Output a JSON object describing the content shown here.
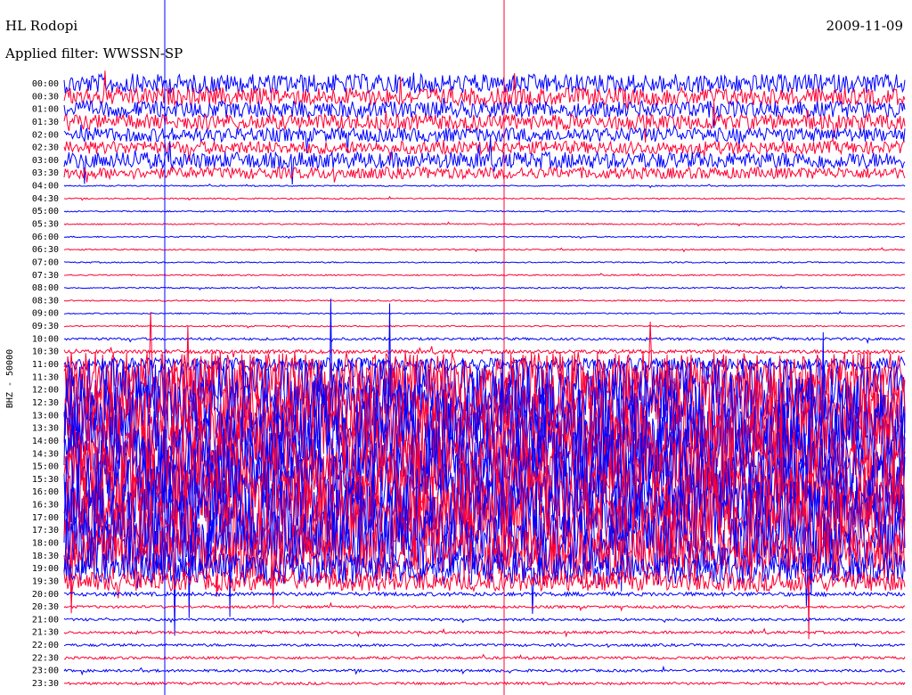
{
  "header": {
    "station": "HL Rodopi",
    "date": "2009-11-09",
    "filter_label": "Applied filter: WWSSN-SP"
  },
  "colors": {
    "trace_a": "#0000ff",
    "trace_b": "#ff0033"
  },
  "chart_data": {
    "type": "line",
    "title": "HL Rodopi",
    "subtitle": "Applied filter: WWSSN-SP",
    "ylabel": "BHZ - 50000",
    "xlabel": "",
    "grid": false,
    "legend": "none",
    "rows": [
      "00:00",
      "00:30",
      "01:00",
      "01:30",
      "02:00",
      "02:30",
      "03:00",
      "03:30",
      "04:00",
      "04:30",
      "05:00",
      "05:30",
      "06:00",
      "06:30",
      "07:00",
      "07:30",
      "08:00",
      "08:30",
      "09:00",
      "09:30",
      "10:00",
      "10:30",
      "11:00",
      "11:30",
      "12:00",
      "12:30",
      "13:00",
      "13:30",
      "14:00",
      "14:30",
      "15:00",
      "15:30",
      "16:00",
      "16:30",
      "17:00",
      "17:30",
      "18:00",
      "18:30",
      "19:00",
      "19:30",
      "20:00",
      "20:30",
      "21:00",
      "21:30",
      "22:00",
      "22:30",
      "23:00",
      "23:30"
    ],
    "row_amplitude": [
      1.5,
      1.4,
      1.3,
      1.2,
      1.1,
      1.0,
      1.3,
      0.9,
      0.1,
      0.1,
      0.1,
      0.1,
      0.1,
      0.1,
      0.1,
      0.1,
      0.1,
      0.1,
      0.1,
      0.1,
      0.2,
      0.3,
      1.0,
      4,
      5,
      6,
      6,
      6,
      6,
      6,
      6,
      6,
      6,
      6,
      6,
      6,
      5,
      4,
      2.5,
      1.5,
      0.3,
      0.2,
      0.2,
      0.2,
      0.2,
      0.2,
      0.2,
      0.2
    ]
  }
}
